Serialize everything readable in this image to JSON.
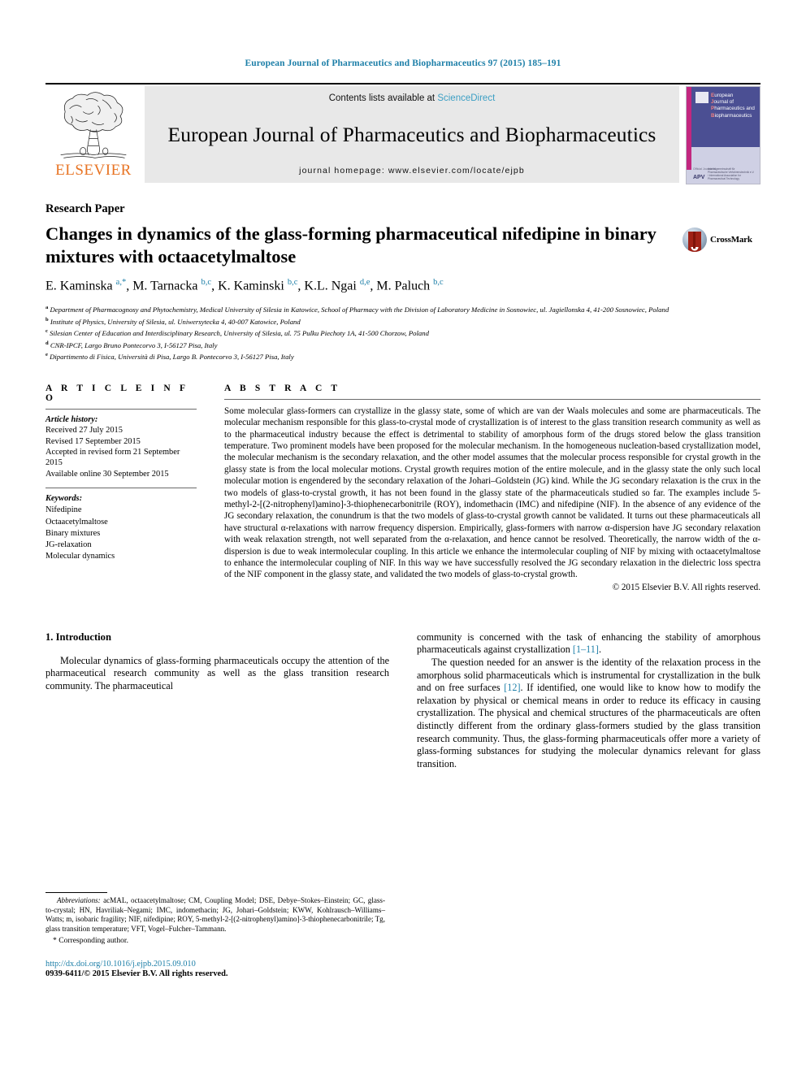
{
  "running_head": "European Journal of Pharmaceutics and Biopharmaceutics 97 (2015) 185–191",
  "masthead": {
    "publisher_name": "ELSEVIER",
    "contents_prefix": "Contents lists available at ",
    "contents_link": "ScienceDirect",
    "journal_name": "European Journal of Pharmaceutics and Biopharmaceutics",
    "homepage": "journal homepage: www.elsevier.com/locate/ejpb",
    "cover": {
      "line1": "uropean",
      "line2": "ournal of",
      "line3": "harmaceutics and",
      "line4": "iopharmaceutics",
      "initials": [
        "E",
        "J",
        "P",
        "B"
      ],
      "official_journal": "Official Journal of",
      "society_abbrev": "APV",
      "society_text": "Arbeitsgemeinschaft für Pharmazeutische Verfahrenstechnik e.V. / International Association for Pharmaceutical Technology"
    },
    "link_color": "#3c9fc4",
    "accent_color": "#1d7fa8"
  },
  "article": {
    "paper_type": "Research Paper",
    "title": "Changes in dynamics of the glass-forming pharmaceutical nifedipine in binary mixtures with octaacetylmaltose",
    "crossmark_label": "CrossMark",
    "authors": [
      {
        "name": "E. Kaminska",
        "marks": "a,*"
      },
      {
        "name": "M. Tarnacka",
        "marks": "b,c"
      },
      {
        "name": "K. Kaminski",
        "marks": "b,c"
      },
      {
        "name": "K.L. Ngai",
        "marks": "d,e"
      },
      {
        "name": "M. Paluch",
        "marks": "b,c"
      }
    ],
    "affiliations": [
      {
        "mark": "a",
        "text": "Department of Pharmacognosy and Phytochemistry, Medical University of Silesia in Katowice, School of Pharmacy with the Division of Laboratory Medicine in Sosnowiec, ul. Jagiellonska 4, 41-200 Sosnowiec, Poland"
      },
      {
        "mark": "b",
        "text": "Institute of Physics, University of Silesia, ul. Uniwersytecka 4, 40-007 Katowice, Poland"
      },
      {
        "mark": "c",
        "text": "Silesian Center of Education and Interdisciplinary Research, University of Silesia, ul. 75 Pulku Piechoty 1A, 41-500 Chorzow, Poland"
      },
      {
        "mark": "d",
        "text": "CNR-IPCF, Largo Bruno Pontecorvo 3, I-56127 Pisa, Italy"
      },
      {
        "mark": "e",
        "text": "Dipartimento di Fisica, Università di Pisa, Largo B. Pontecorvo 3, I-56127 Pisa, Italy"
      }
    ]
  },
  "article_info": {
    "heading": "A R T I C L E   I N F O",
    "history_label": "Article history:",
    "history": [
      "Received 27 July 2015",
      "Revised 17 September 2015",
      "Accepted in revised form 21 September 2015",
      "Available online 30 September 2015"
    ],
    "keywords_label": "Keywords:",
    "keywords": [
      "Nifedipine",
      "Octaacetylmaltose",
      "Binary mixtures",
      "JG-relaxation",
      "Molecular dynamics"
    ]
  },
  "abstract": {
    "heading": "A B S T R A C T",
    "text": "Some molecular glass-formers can crystallize in the glassy state, some of which are van der Waals molecules and some are pharmaceuticals. The molecular mechanism responsible for this glass-to-crystal mode of crystallization is of interest to the glass transition research community as well as to the pharmaceutical industry because the effect is detrimental to stability of amorphous form of the drugs stored below the glass transition temperature. Two prominent models have been proposed for the molecular mechanism. In the homogeneous nucleation-based crystallization model, the molecular mechanism is the secondary relaxation, and the other model assumes that the molecular process responsible for crystal growth in the glassy state is from the local molecular motions. Crystal growth requires motion of the entire molecule, and in the glassy state the only such local molecular motion is engendered by the secondary relaxation of the Johari–Goldstein (JG) kind. While the JG secondary relaxation is the crux in the two models of glass-to-crystal growth, it has not been found in the glassy state of the pharmaceuticals studied so far. The examples include 5-methyl-2-[(2-nitrophenyl)amino]-3-thiophenecarbonitrile (ROY), indomethacin (IMC) and nifedipine (NIF). In the absence of any evidence of the JG secondary relaxation, the conundrum is that the two models of glass-to-crystal growth cannot be validated. It turns out these pharmaceuticals all have structural α-relaxations with narrow frequency dispersion. Empirically, glass-formers with narrow α-dispersion have JG secondary relaxation with weak relaxation strength, not well separated from the α-relaxation, and hence cannot be resolved. Theoretically, the narrow width of the α-dispersion is due to weak intermolecular coupling. In this article we enhance the intermolecular coupling of NIF by mixing with octaacetylmaltose to enhance the intermolecular coupling of NIF. In this way we have successfully resolved the JG secondary relaxation in the dielectric loss spectra of the NIF component in the glassy state, and validated the two models of glass-to-crystal growth.",
    "copyright": "© 2015 Elsevier B.V. All rights reserved."
  },
  "introduction": {
    "heading": "1. Introduction",
    "left_paragraph_1": "Molecular dynamics of glass-forming pharmaceuticals occupy the attention of the pharmaceutical research community as well as the glass transition research community. The pharmaceutical",
    "right_paragraph_1_cont": "community is concerned with the task of enhancing the stability of amorphous pharmaceuticals against crystallization ",
    "ref_1_11": "[1–11]",
    "right_paragraph_2_a": "The question needed for an answer is the identity of the relaxation process in the amorphous solid pharmaceuticals which is instrumental for crystallization in the bulk and on free surfaces ",
    "ref_12": "[12]",
    "right_paragraph_2_b": ". If identified, one would like to know how to modify the relaxation by physical or chemical means in order to reduce its efficacy in causing crystallization. The physical and chemical structures of the pharmaceuticals are often distinctly different from the ordinary glass-formers studied by the glass transition research community. Thus, the glass-forming pharmaceuticals offer more a variety of glass-forming substances for studying the molecular dynamics relevant for glass transition."
  },
  "footnotes": {
    "abbreviations_label": "Abbreviations:",
    "abbreviations_text": " acMAL, octaacetylmaltose; CM, Coupling Model; DSE, Debye–Stokes–Einstein; GC, glass-to-crystal; HN, Havriliak–Negami; IMC, indomethacin; JG, Johari–Goldstein; KWW, Kohlrausch–Williams–Watts; m, isobaric fragility; NIF, nifedipine; ROY, 5-methyl-2-[(2-nitrophenyl)amino]-3-thiophenecarbonitrile; Tg, glass transition temperature; VFT, Vogel–Fulcher–Tammann.",
    "corresponding_author": "* Corresponding author.",
    "doi": "http://dx.doi.org/10.1016/j.ejpb.2015.09.010",
    "issn_line": "0939-6411/© 2015 Elsevier B.V. All rights reserved."
  }
}
